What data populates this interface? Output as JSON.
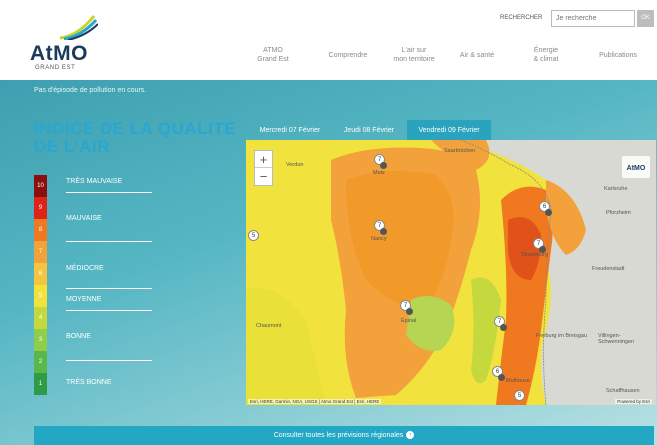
{
  "header": {
    "logo_text": "AtMO",
    "logo_sub": "GRAND EST",
    "search_label": "RECHERCHER",
    "search_placeholder": "Je recherche",
    "search_button": "OK",
    "nav": [
      {
        "line1": "ATMO",
        "line2": "Grand Est"
      },
      {
        "line1": "Comprendre",
        "line2": ""
      },
      {
        "line1": "L'air sur",
        "line2": "mon territoire"
      },
      {
        "line1": "Air & santé",
        "line2": ""
      },
      {
        "line1": "Énergie",
        "line2": "& climat"
      },
      {
        "line1": "Publications",
        "line2": ""
      }
    ]
  },
  "status": "Pas d'épisode de pollution en cours.",
  "aq_title_line1": "INDICE DE LA QUALITÉ",
  "aq_title_line2": "DE L'AIR",
  "scale": [
    {
      "value": "10",
      "color": "#8b0f0f"
    },
    {
      "value": "9",
      "color": "#e02318"
    },
    {
      "value": "8",
      "color": "#f0781e"
    },
    {
      "value": "7",
      "color": "#f3a13a"
    },
    {
      "value": "6",
      "color": "#f5c542"
    },
    {
      "value": "5",
      "color": "#f2e23c"
    },
    {
      "value": "4",
      "color": "#c5d93e"
    },
    {
      "value": "3",
      "color": "#8fcd4a"
    },
    {
      "value": "2",
      "color": "#58b94a"
    },
    {
      "value": "1",
      "color": "#2f9c45"
    }
  ],
  "scale_labels": [
    "TRÈS MAUVAISE",
    "MAUVAISE",
    "MÉDIOCRE",
    "MOYENNE",
    "BONNE",
    "TRÈS BONNE"
  ],
  "tabs": [
    "Mercredi 07 Février",
    "Jeudi 08 Février",
    "Vendredi 09 Février"
  ],
  "active_tab": "Vendredi 09 Février",
  "map": {
    "zoom_in": "+",
    "zoom_out": "−",
    "map_logo": "AtMO",
    "cities": [
      "Verdun",
      "Saarbrücken",
      "Karlsruhe",
      "Pforzheim",
      "Freudenstadt",
      "Chaumont",
      "Freiburg im Breisgau",
      "Villingen-Schwenningen",
      "Schaffhausen",
      "Mulhouse",
      "Strasbourg",
      "Nancy",
      "Metz",
      "Épinal"
    ],
    "pins": [
      "7",
      "7",
      "6",
      "7",
      "7",
      "7",
      "6",
      "5",
      "5"
    ],
    "attribution": "Esri, HERE, Garmin, NGA, USGS | Atmo Grand Est | Esri, HERE",
    "powered": "Powered by Esri"
  },
  "cta": "Consulter toutes les prévisions régionales",
  "cta_icon": "arrow-right-icon"
}
